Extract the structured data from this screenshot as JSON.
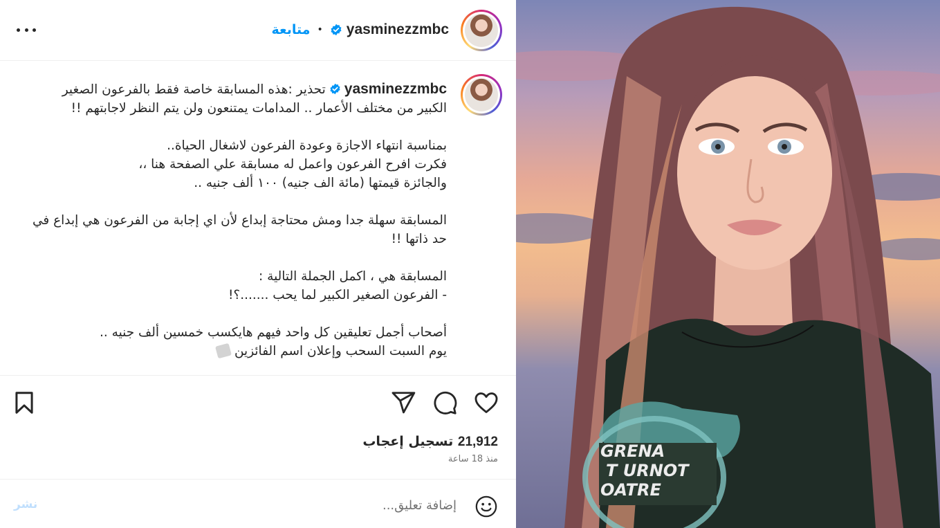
{
  "header": {
    "username": "yasminezzmbc",
    "separator": "•",
    "follow_label": "متابعة",
    "more_icon": "more-horizontal-icon"
  },
  "caption": {
    "username": "yasminezzmbc",
    "text": "تحذير :هذه المسابقة خاصة فقط بالفرعون الصغير الكبير من مختلف الأعمار .. المدامات يمتنعون ولن يتم النظر لاجابتهم !!\n\nبمناسبة انتهاء الاجازة وعودة الفرعون لاشغال الحياة..\nفكرت افرح الفرعون واعمل له مسابقة علي الصفحة هنا ،،\nوالجائزة قيمتها (مائة الف جنيه) ١٠٠ ألف جنيه ..\n\nالمسابقة سهلة جدا ومش محتاجة إبداع لأن اي إجابة من الفرعون هي إبداع في حد ذاتها !!\n\nالمسابقة هي ، اكمل الجملة التالية :\n- الفرعون الصغير الكبير لما يحب .......؟!\n\nأصحاب أجمل تعليقين كل واحد فيهم هايكسب خمسين ألف جنيه ..\nيوم السبت السحب وإعلان اسم الفائزين"
  },
  "actions": {
    "like_icon": "heart-icon",
    "comment_icon": "comment-bubble-icon",
    "share_icon": "paper-plane-icon",
    "save_icon": "bookmark-icon"
  },
  "likes": {
    "count": "21,912",
    "label": "تسجيل إعجاب"
  },
  "timestamp": "منذ 18 ساعة",
  "comment": {
    "placeholder": "إضافة تعليق...",
    "post_label": "نشر",
    "emoji_icon": "smiley-icon"
  },
  "media": {
    "shirt_text": [
      "GRENA",
      "T URNOT",
      "OATRE"
    ]
  },
  "colors": {
    "accent": "#0095f6",
    "verified": "#0095f6",
    "post_disabled": "#c0dffd",
    "text": "#262626",
    "muted": "#737373"
  }
}
